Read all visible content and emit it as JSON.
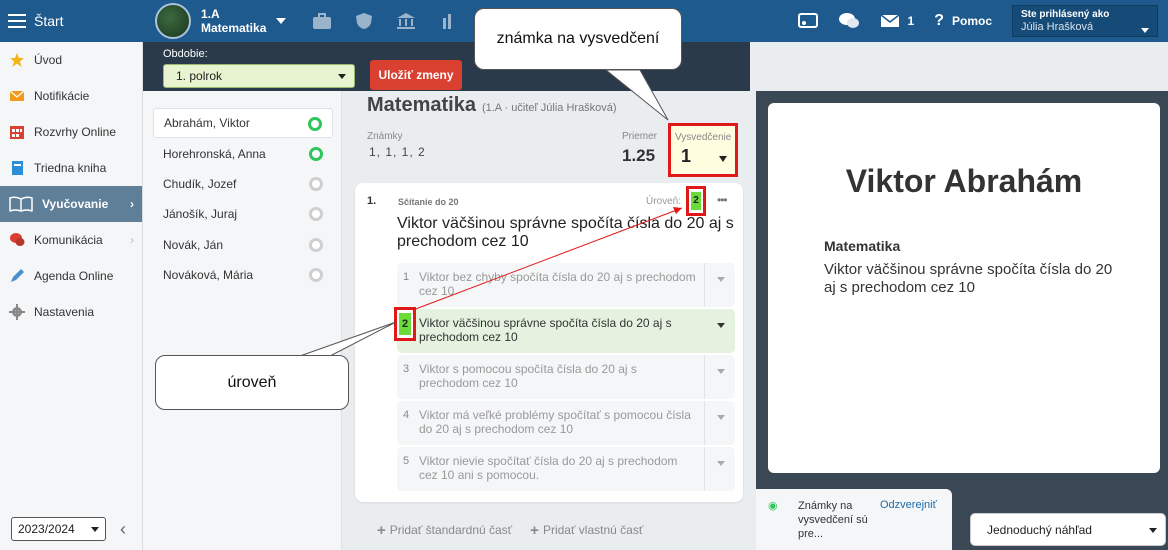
{
  "topbar": {
    "start_label": "Štart",
    "class_name": "1.A",
    "class_subject": "Matematika",
    "message_count": "1",
    "help_label": "Pomoc",
    "user_prefix": "Ste prihlásený ako",
    "user_name": "Júlia Hrašková"
  },
  "sidebar": {
    "items": [
      {
        "label": "Úvod",
        "icon": "star-icon"
      },
      {
        "label": "Notifikácie",
        "icon": "mail-icon"
      },
      {
        "label": "Rozvrhy Online",
        "icon": "calendar-icon"
      },
      {
        "label": "Triedna kniha",
        "icon": "book-icon"
      },
      {
        "label": "Vyučovanie",
        "icon": "open-book-icon"
      },
      {
        "label": "Komunikácia",
        "icon": "chat-icon"
      },
      {
        "label": "Agenda Online",
        "icon": "pen-icon"
      },
      {
        "label": "Nastavenia",
        "icon": "gear-icon"
      }
    ],
    "year": "2023/2024"
  },
  "period": {
    "label": "Obdobie:",
    "value": "1. polrok",
    "save_label": "Uložiť zmeny"
  },
  "students": [
    {
      "name": "Abrahám, Viktor",
      "status": "on"
    },
    {
      "name": "Horehronská, Anna",
      "status": "on"
    },
    {
      "name": "Chudík, Jozef",
      "status": "off"
    },
    {
      "name": "Jánošík, Juraj",
      "status": "off"
    },
    {
      "name": "Novák, Ján",
      "status": "off"
    },
    {
      "name": "Nováková, Mária",
      "status": "off"
    }
  ],
  "subject": {
    "title": "Matematika",
    "subtitle": "(1.A · učiteľ Júlia Hrašková)",
    "grades_label": "Známky",
    "grades": "1, 1, 1, 2",
    "avg_label": "Priemer",
    "avg_value": "1.25",
    "report_label": "Vysvedčenie",
    "report_value": "1"
  },
  "card": {
    "number": "1.",
    "standard": "Sčítanie do 20",
    "level_label": "Úroveň:",
    "level_value": "2",
    "more": "•••",
    "description": "Viktor väčšinou správne spočíta čísla do 20 aj s prechodom cez 10",
    "options": [
      {
        "num": "1",
        "text": "Viktor bez chyby spočíta čísla do 20 aj s prechodom cez 10"
      },
      {
        "num": "2",
        "text": "Viktor väčšinou správne spočíta čísla do 20 aj s prechodom cez 10"
      },
      {
        "num": "3",
        "text": "Viktor s pomocou spočíta čísla do 20 aj s prechodom cez 10"
      },
      {
        "num": "4",
        "text": "Viktor má veľké problémy spočítať s pomocou čísla do 20 aj s prechodom cez 10"
      },
      {
        "num": "5",
        "text": "Viktor nievie spočítať čísla do 20 aj s prechodom cez 10 ani s pomocou."
      }
    ],
    "add_standard": "Pridať štandardnú časť",
    "add_custom": "Pridať vlastnú časť"
  },
  "preview": {
    "name": "Viktor Abrahám",
    "subject": "Matematika",
    "text": "Viktor väčšinou správne spočíta čísla do 20 aj s prechodom cez 10",
    "publish_text": "Známky na vysvedčení sú pre...",
    "publish_link": "Odzverejniť",
    "view_mode": "Jednoduchý náhľad"
  },
  "callouts": {
    "report_grade": "známka na  vysvedčení",
    "level": "úroveň"
  }
}
